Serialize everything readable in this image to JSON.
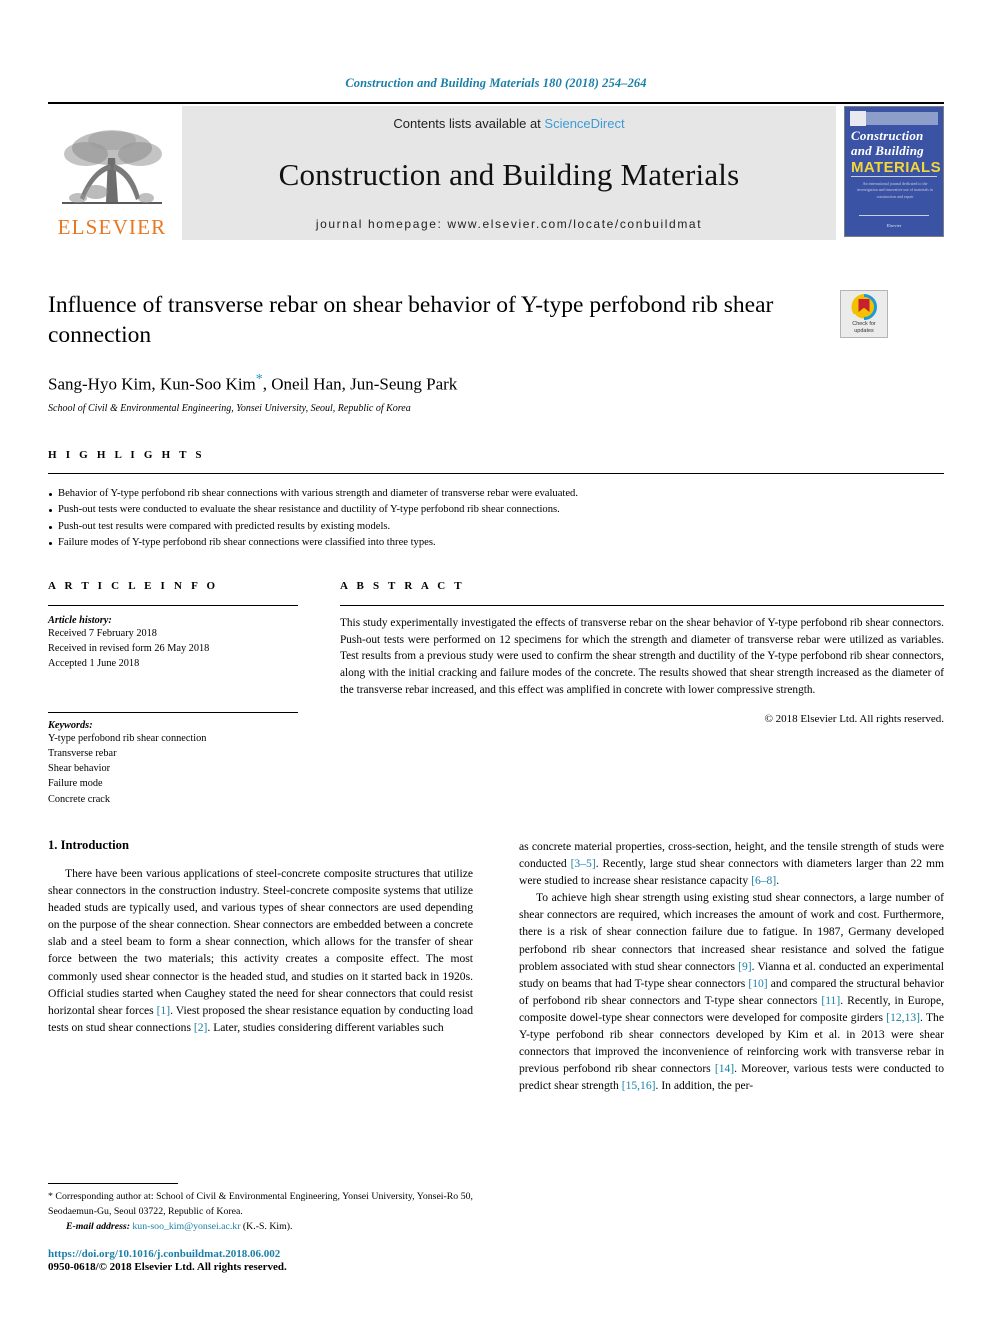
{
  "running_head": "Construction and Building Materials 180 (2018) 254–264",
  "masthead": {
    "publisher_name": "ELSEVIER",
    "contents_prefix": "Contents lists available at ",
    "contents_link": "ScienceDirect",
    "journal_title": "Construction and Building Materials",
    "homepage": "journal homepage: www.elsevier.com/locate/conbuildmat",
    "cover": {
      "line1": "Construction",
      "line2": "and Building",
      "line3": "MATERIALS",
      "blurb": "An international journal dedicated to the investigation and innovative use of materials in construction and repair",
      "foot": "Elsevier"
    }
  },
  "article": {
    "title": "Influence of transverse rebar on shear behavior of Y-type perfobond rib shear connection",
    "authors_part1": "Sang-Hyo Kim, Kun-Soo Kim",
    "authors_star": "*",
    "authors_part2": ", Oneil Han, Jun-Seung Park",
    "affiliation": "School of Civil & Environmental Engineering, Yonsei University, Seoul, Republic of Korea",
    "crossmark_line1": "Check for",
    "crossmark_line2": "updates"
  },
  "highlights": {
    "heading": "H I G H L I G H T S",
    "items": [
      "Behavior of Y-type perfobond rib shear connections with various strength and diameter of transverse rebar were evaluated.",
      "Push-out tests were conducted to evaluate the shear resistance and ductility of Y-type perfobond rib shear connections.",
      "Push-out test results were compared with predicted results by existing models.",
      "Failure modes of Y-type perfobond rib shear connections were classified into three types."
    ]
  },
  "article_info": {
    "heading": "A R T I C L E   I N F O",
    "history_label": "Article history:",
    "history": [
      "Received 7 February 2018",
      "Received in revised form 26 May 2018",
      "Accepted 1 June 2018"
    ],
    "keywords_label": "Keywords:",
    "keywords": [
      "Y-type perfobond rib shear connection",
      "Transverse rebar",
      "Shear behavior",
      "Failure mode",
      "Concrete crack"
    ]
  },
  "abstract": {
    "heading": "A B S T R A C T",
    "text": "This study experimentally investigated the effects of transverse rebar on the shear behavior of Y-type perfobond rib shear connectors. Push-out tests were performed on 12 specimens for which the strength and diameter of transverse rebar were utilized as variables. Test results from a previous study were used to confirm the shear strength and ductility of the Y-type perfobond rib shear connectors, along with the initial cracking and failure modes of the concrete. The results showed that shear strength increased as the diameter of the transverse rebar increased, and this effect was amplified in concrete with lower compressive strength.",
    "copyright": "© 2018 Elsevier Ltd. All rights reserved."
  },
  "body": {
    "section_heading": "1. Introduction",
    "left_paragraph_1_a": "There have been various applications of steel-concrete composite structures that utilize shear connectors in the construction industry. Steel-concrete composite systems that utilize headed studs are typically used, and various types of shear connectors are used depending on the purpose of the shear connection. Shear connectors are embedded between a concrete slab and a steel beam to form a shear connection, which allows for the transfer of shear force between the two materials; this activity creates a composite effect. The most commonly used shear connector is the headed stud, and studies on it started back in 1920s. Official studies started when Caughey stated the need for shear connectors that could resist horizontal shear forces ",
    "ref_1": "[1]",
    "left_paragraph_1_b": ". Viest proposed the shear resistance equation by conducting load tests on stud shear connections ",
    "ref_2": "[2]",
    "left_paragraph_1_c": ". Later, studies considering different variables such ",
    "right_cont_a": "as concrete material properties, cross-section, height, and the tensile strength of studs were conducted ",
    "ref_3_5": "[3–5]",
    "right_cont_b": ". Recently, large stud shear connectors with diameters larger than 22 mm were studied to increase shear resistance capacity ",
    "ref_6_8": "[6–8]",
    "right_cont_c": ".",
    "right_paragraph_2_a": "To achieve high shear strength using existing stud shear connectors, a large number of shear connectors are required, which increases the amount of work and cost. Furthermore, there is a risk of shear connection failure due to fatigue. In 1987, Germany developed perfobond rib shear connectors that increased shear resistance and solved the fatigue problem associated with stud shear connectors ",
    "ref_9": "[9]",
    "right_paragraph_2_b": ". Vianna et al. conducted an experimental study on beams that had T-type shear connectors ",
    "ref_10": "[10]",
    "right_paragraph_2_c": " and compared the structural behavior of perfobond rib shear connectors and T-type shear connectors ",
    "ref_11": "[11]",
    "right_paragraph_2_d": ". Recently, in Europe, composite dowel-type shear connectors were developed for composite girders ",
    "ref_12_13": "[12,13]",
    "right_paragraph_2_e": ". The Y-type perfobond rib shear connectors developed by Kim et al. in 2013 were shear connectors that improved the inconvenience of reinforcing work with transverse rebar in previous perfobond rib shear connectors ",
    "ref_14": "[14]",
    "right_paragraph_2_f": ". Moreover, various tests were conducted to predict shear strength ",
    "ref_15_16": "[15,16]",
    "right_paragraph_2_g": ". In addition, the per-"
  },
  "footnotes": {
    "corresponding": "* Corresponding author at: School of Civil & Environmental Engineering, Yonsei University, Yonsei-Ro 50, Seodaemun-Gu, Seoul 03722, Republic of Korea.",
    "email_label": "E-mail address:",
    "email": "kun-soo_kim@yonsei.ac.kr",
    "email_suffix": " (K.-S. Kim).",
    "doi": "https://doi.org/10.1016/j.conbuildmat.2018.06.002",
    "issn": "0950-0618/© 2018 Elsevier Ltd. All rights reserved."
  }
}
